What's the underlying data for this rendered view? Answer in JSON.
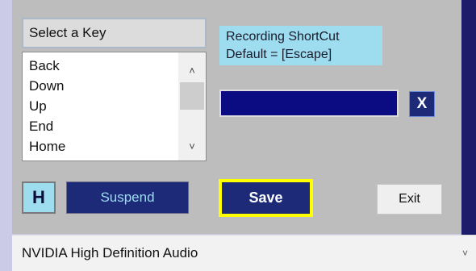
{
  "key_selector": {
    "label": "Select a Key",
    "items": [
      "Back",
      "Down",
      "Up",
      "End",
      "Home"
    ]
  },
  "recording": {
    "title": "Recording ShortCut",
    "default_text": "Default = [Escape]",
    "shortcut_value": ""
  },
  "buttons": {
    "clear_label": "X",
    "h_label": "H",
    "suspend_label": "Suspend",
    "save_label": "Save",
    "exit_label": "Exit"
  },
  "audio_device": {
    "selected": "NVIDIA High Definition Audio"
  },
  "colors": {
    "window_background": "#bdbdbd",
    "dark_blue": "#1c2a78",
    "light_cyan": "#9edcf0",
    "highlight_yellow": "#ffff00"
  },
  "icons": {
    "scroll_up": "chevron-up-icon",
    "scroll_down": "chevron-down-icon",
    "dropdown": "chevron-down-icon"
  }
}
